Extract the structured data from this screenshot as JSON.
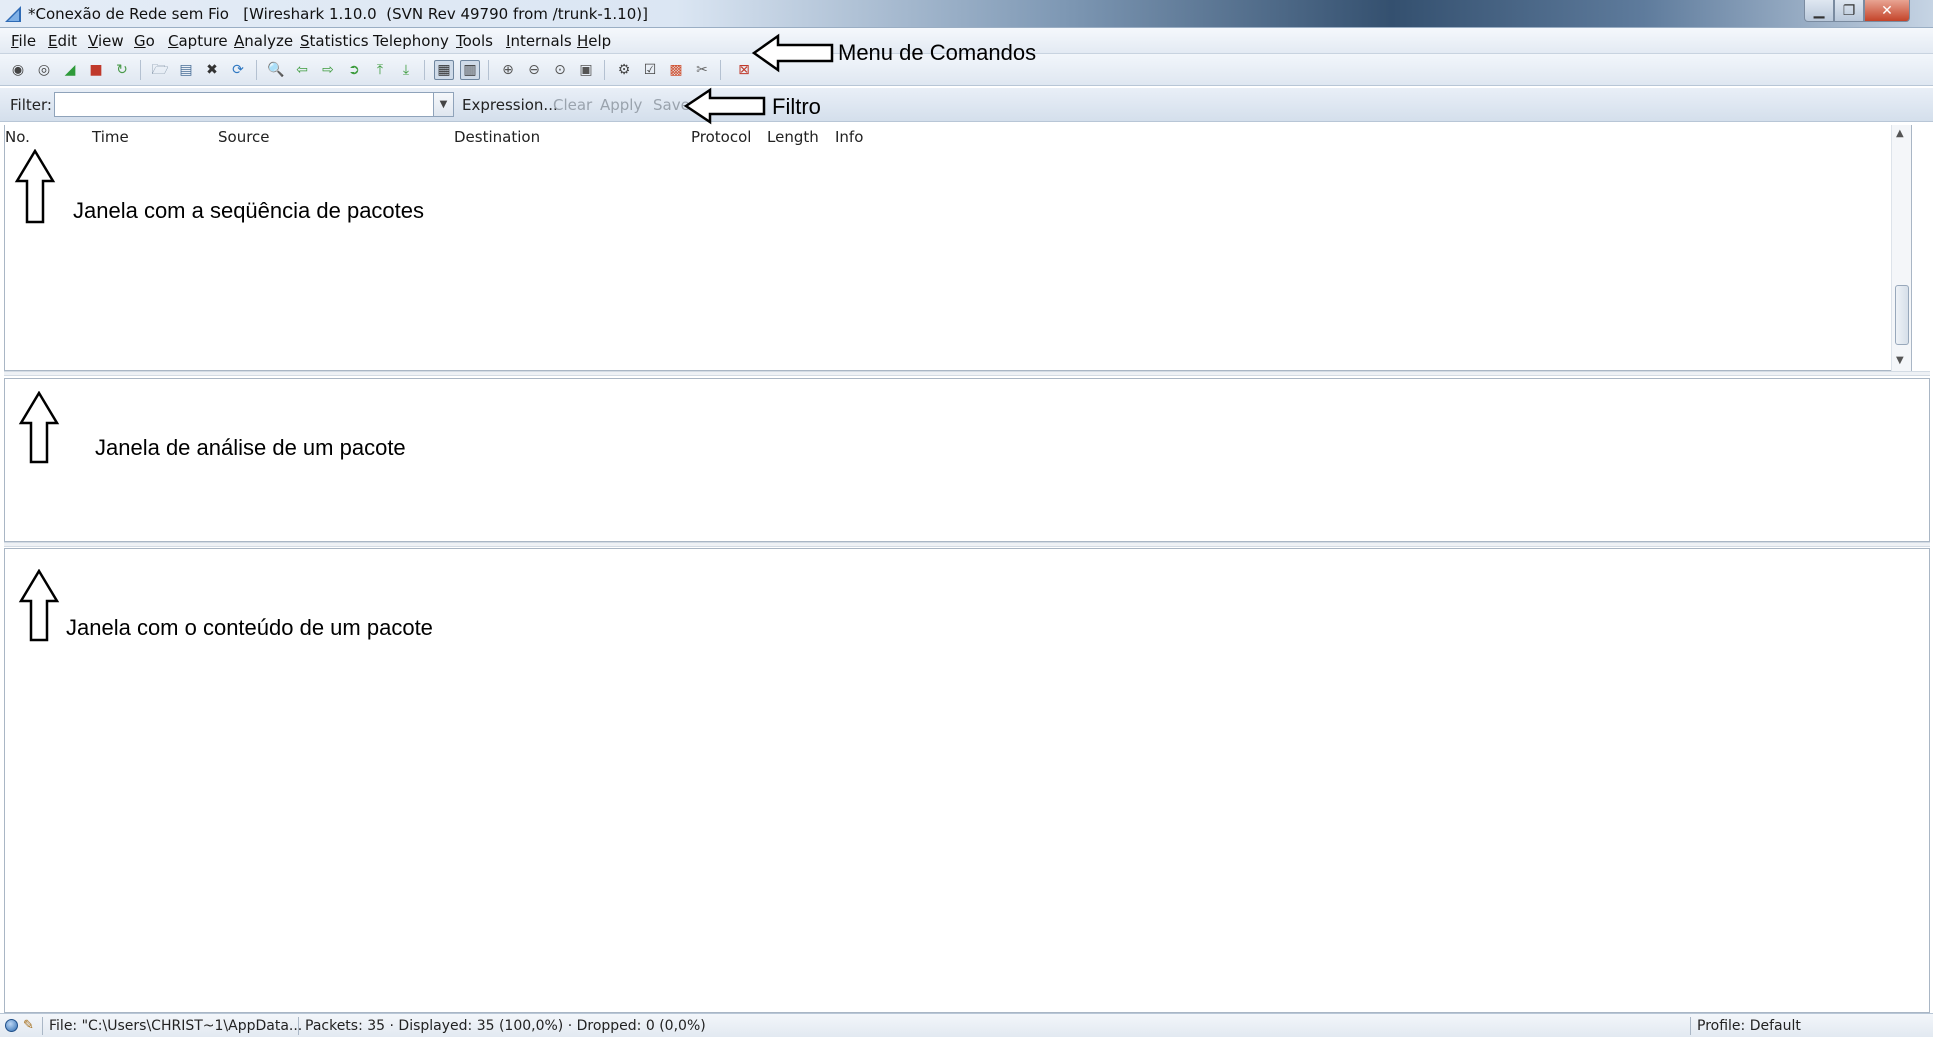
{
  "window": {
    "title": "*Conexão de Rede sem Fio   [Wireshark 1.10.0  (SVN Rev 49790 from /trunk-1.10)]",
    "controls": {
      "minimize": "▁",
      "maximize": "❐",
      "close": "✕"
    }
  },
  "menu": {
    "items": [
      {
        "label": "File",
        "accel": "F",
        "rest": "ile"
      },
      {
        "label": "Edit",
        "accel": "E",
        "rest": "dit"
      },
      {
        "label": "View",
        "accel": "V",
        "rest": "iew"
      },
      {
        "label": "Go",
        "accel": "G",
        "rest": "o"
      },
      {
        "label": "Capture",
        "accel": "C",
        "rest": "apture"
      },
      {
        "label": "Analyze",
        "accel": "A",
        "rest": "nalyze"
      },
      {
        "label": "Statistics",
        "accel": "S",
        "rest": "tatistics"
      },
      {
        "label": "Telephony",
        "accel": "",
        "rest": "Telephony"
      },
      {
        "label": "Tools",
        "accel": "T",
        "rest": "ools"
      },
      {
        "label": "Internals",
        "accel": "I",
        "rest": "nternals"
      },
      {
        "label": "Help",
        "accel": "H",
        "rest": "elp"
      }
    ]
  },
  "toolbar": {
    "icons": [
      {
        "name": "interfaces-icon",
        "glyph": "◉"
      },
      {
        "name": "capture-options-icon",
        "glyph": "◎"
      },
      {
        "name": "start-capture-icon",
        "glyph": "◢"
      },
      {
        "name": "stop-capture-icon",
        "glyph": "■"
      },
      {
        "name": "restart-capture-icon",
        "glyph": "↻"
      },
      {
        "name": "open-file-icon",
        "glyph": "🗁"
      },
      {
        "name": "save-file-icon",
        "glyph": "▤"
      },
      {
        "name": "close-file-icon",
        "glyph": "✖"
      },
      {
        "name": "reload-icon",
        "glyph": "⟳"
      },
      {
        "name": "find-packet-icon",
        "glyph": "🔍"
      },
      {
        "name": "go-back-icon",
        "glyph": "⇦"
      },
      {
        "name": "go-forward-icon",
        "glyph": "⇨"
      },
      {
        "name": "go-to-packet-icon",
        "glyph": "➲"
      },
      {
        "name": "go-first-icon",
        "glyph": "⤒"
      },
      {
        "name": "go-last-icon",
        "glyph": "⤓"
      },
      {
        "name": "colorize-icon",
        "glyph": "▦"
      },
      {
        "name": "autoscroll-icon",
        "glyph": "▥"
      },
      {
        "name": "zoom-in-icon",
        "glyph": "⊕"
      },
      {
        "name": "zoom-out-icon",
        "glyph": "⊖"
      },
      {
        "name": "zoom-normal-icon",
        "glyph": "⊙"
      },
      {
        "name": "resize-columns-icon",
        "glyph": "▣"
      },
      {
        "name": "capture-filters-icon",
        "glyph": "⚙"
      },
      {
        "name": "display-filters-icon",
        "glyph": "☑"
      },
      {
        "name": "coloring-rules-icon",
        "glyph": "▩"
      },
      {
        "name": "preferences-icon",
        "glyph": "✂"
      },
      {
        "name": "help-icon",
        "glyph": "⊠"
      }
    ]
  },
  "filter": {
    "label": "Filter:",
    "value": "",
    "expression": "Expression...",
    "clear": "Clear",
    "apply": "Apply",
    "save": "Save"
  },
  "packet_list": {
    "columns": [
      "No.",
      "Time",
      "Source",
      "Destination",
      "Protocol",
      "Length",
      "Info"
    ]
  },
  "annotations": {
    "menu": "Menu de Comandos",
    "filter": "Filtro",
    "packet_list": "Janela com a seqüência de pacotes",
    "packet_details": "Janela de análise de um pacote",
    "packet_bytes": "Janela com o conteúdo de um pacote"
  },
  "status": {
    "file": "File: \"C:\\Users\\CHRIST~1\\AppData...",
    "packets": "Packets: 35 · Displayed: 35 (100,0%) · Dropped: 0 (0,0%)",
    "profile": "Profile: Default"
  }
}
